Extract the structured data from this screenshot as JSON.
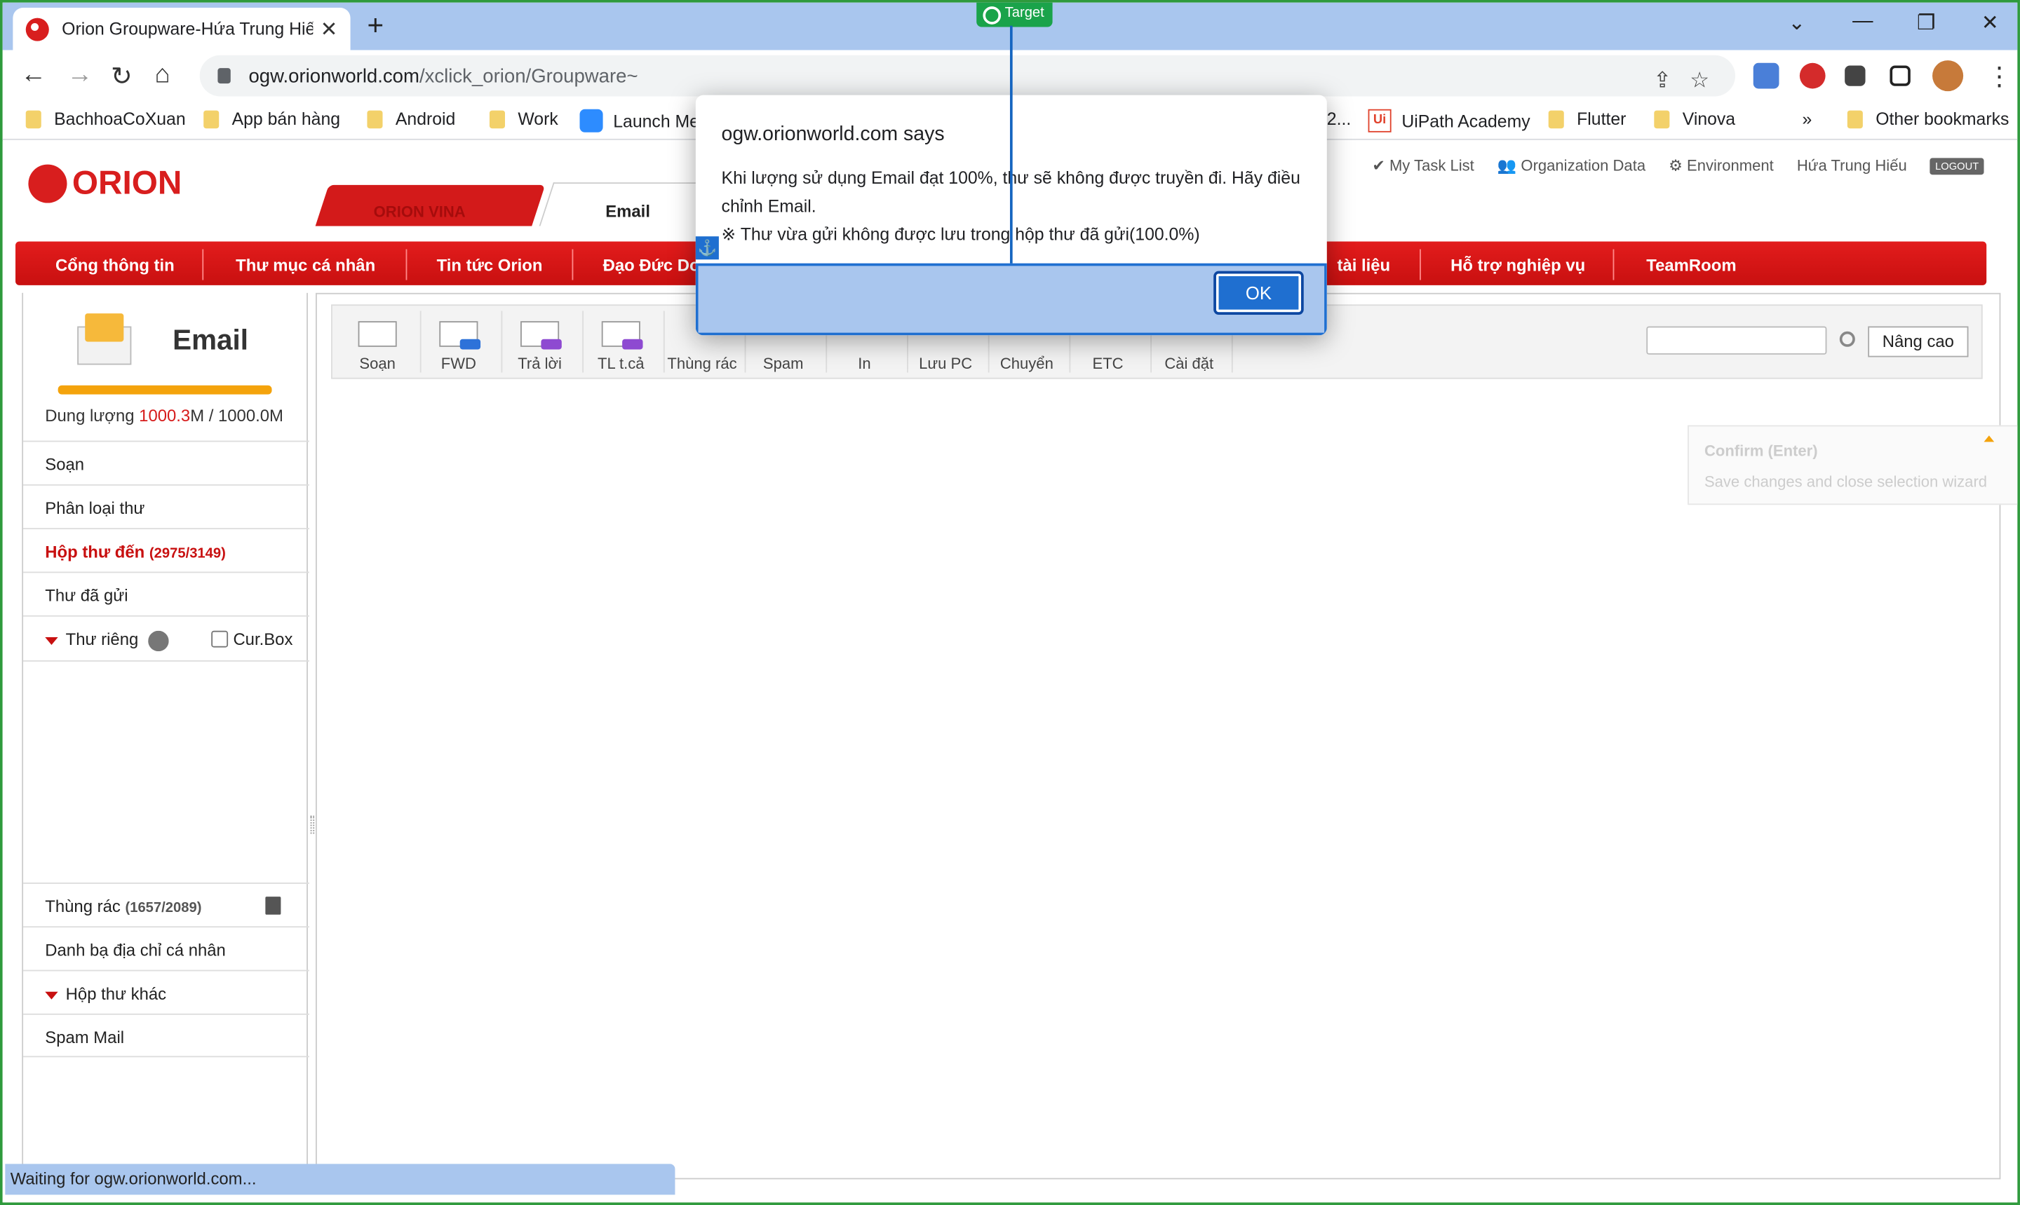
{
  "browser": {
    "tab_title": "Orion Groupware-Hứa Trung Hiế",
    "url_domain": "ogw.orionworld.com",
    "url_path": "/xclick_orion/Groupware~",
    "target_label": "Target",
    "status_text": "Waiting for ogw.orionworld.com...",
    "bookmarks": [
      "BachhoaCoXuan",
      "App bán hàng",
      "Android",
      "Work",
      "Launch Me",
      "2...",
      "UiPath Academy",
      "Flutter",
      "Vinova",
      "»",
      "Other bookmarks"
    ]
  },
  "header": {
    "logo_text": "ORION",
    "tab_vina": "ORION VINA",
    "tab_email": "Email",
    "links": [
      "My Task List",
      "Organization Data",
      "Environment",
      "Hứa Trung Hiếu"
    ],
    "logout": "LOGOUT"
  },
  "menu": [
    "Cổng thông tin",
    "Thư mục cá nhân",
    "Tin tức Orion",
    "Đạo Đức Do",
    "tài liệu",
    "Hỗ trợ nghiệp vụ",
    "TeamRoom"
  ],
  "sidebar": {
    "title": "Email",
    "quota_label": "Dung lượng ",
    "quota_used": "1000.3",
    "quota_rest": "M / 1000.0M",
    "quota_percent": 100,
    "items": {
      "compose": "Soạn",
      "classify": "Phân loại thư",
      "inbox": "Hộp thư đến",
      "inbox_count": "(2975/3149)",
      "sent": "Thư đã gửi",
      "private": "Thư riêng",
      "curbox": "Cur.Box",
      "trash": "Thùng rác",
      "trash_count": "(1657/2089)",
      "contacts": "Danh bạ địa chỉ cá nhân",
      "other": "Hộp thư khác",
      "spam": "Spam Mail"
    }
  },
  "toolbar": {
    "buttons": [
      "Soạn",
      "FWD",
      "Trả lời",
      "TL t.cả",
      "Thùng rác",
      "Spam",
      "In",
      "Lưu PC",
      "Chuyển",
      "ETC",
      "Cài đặt"
    ],
    "advanced": "Nâng cao"
  },
  "confirm_hint": {
    "title": "Confirm (Enter)",
    "subtitle": "Save changes and close selection wizard"
  },
  "dialog": {
    "title": "ogw.orionworld.com says",
    "line1": "Khi lượng sử dụng Email đạt 100%, thư sẽ không được truyền đi. Hãy điều chỉnh Email.",
    "line2": "※ Thư vừa gửi không được lưu trong hộp thư đã gửi(100.0%)",
    "ok": "OK"
  },
  "colors": {
    "brand_red": "#d81e1e",
    "dialog_accent": "#1f6fd0",
    "quota_bar": "#f4a30c"
  }
}
